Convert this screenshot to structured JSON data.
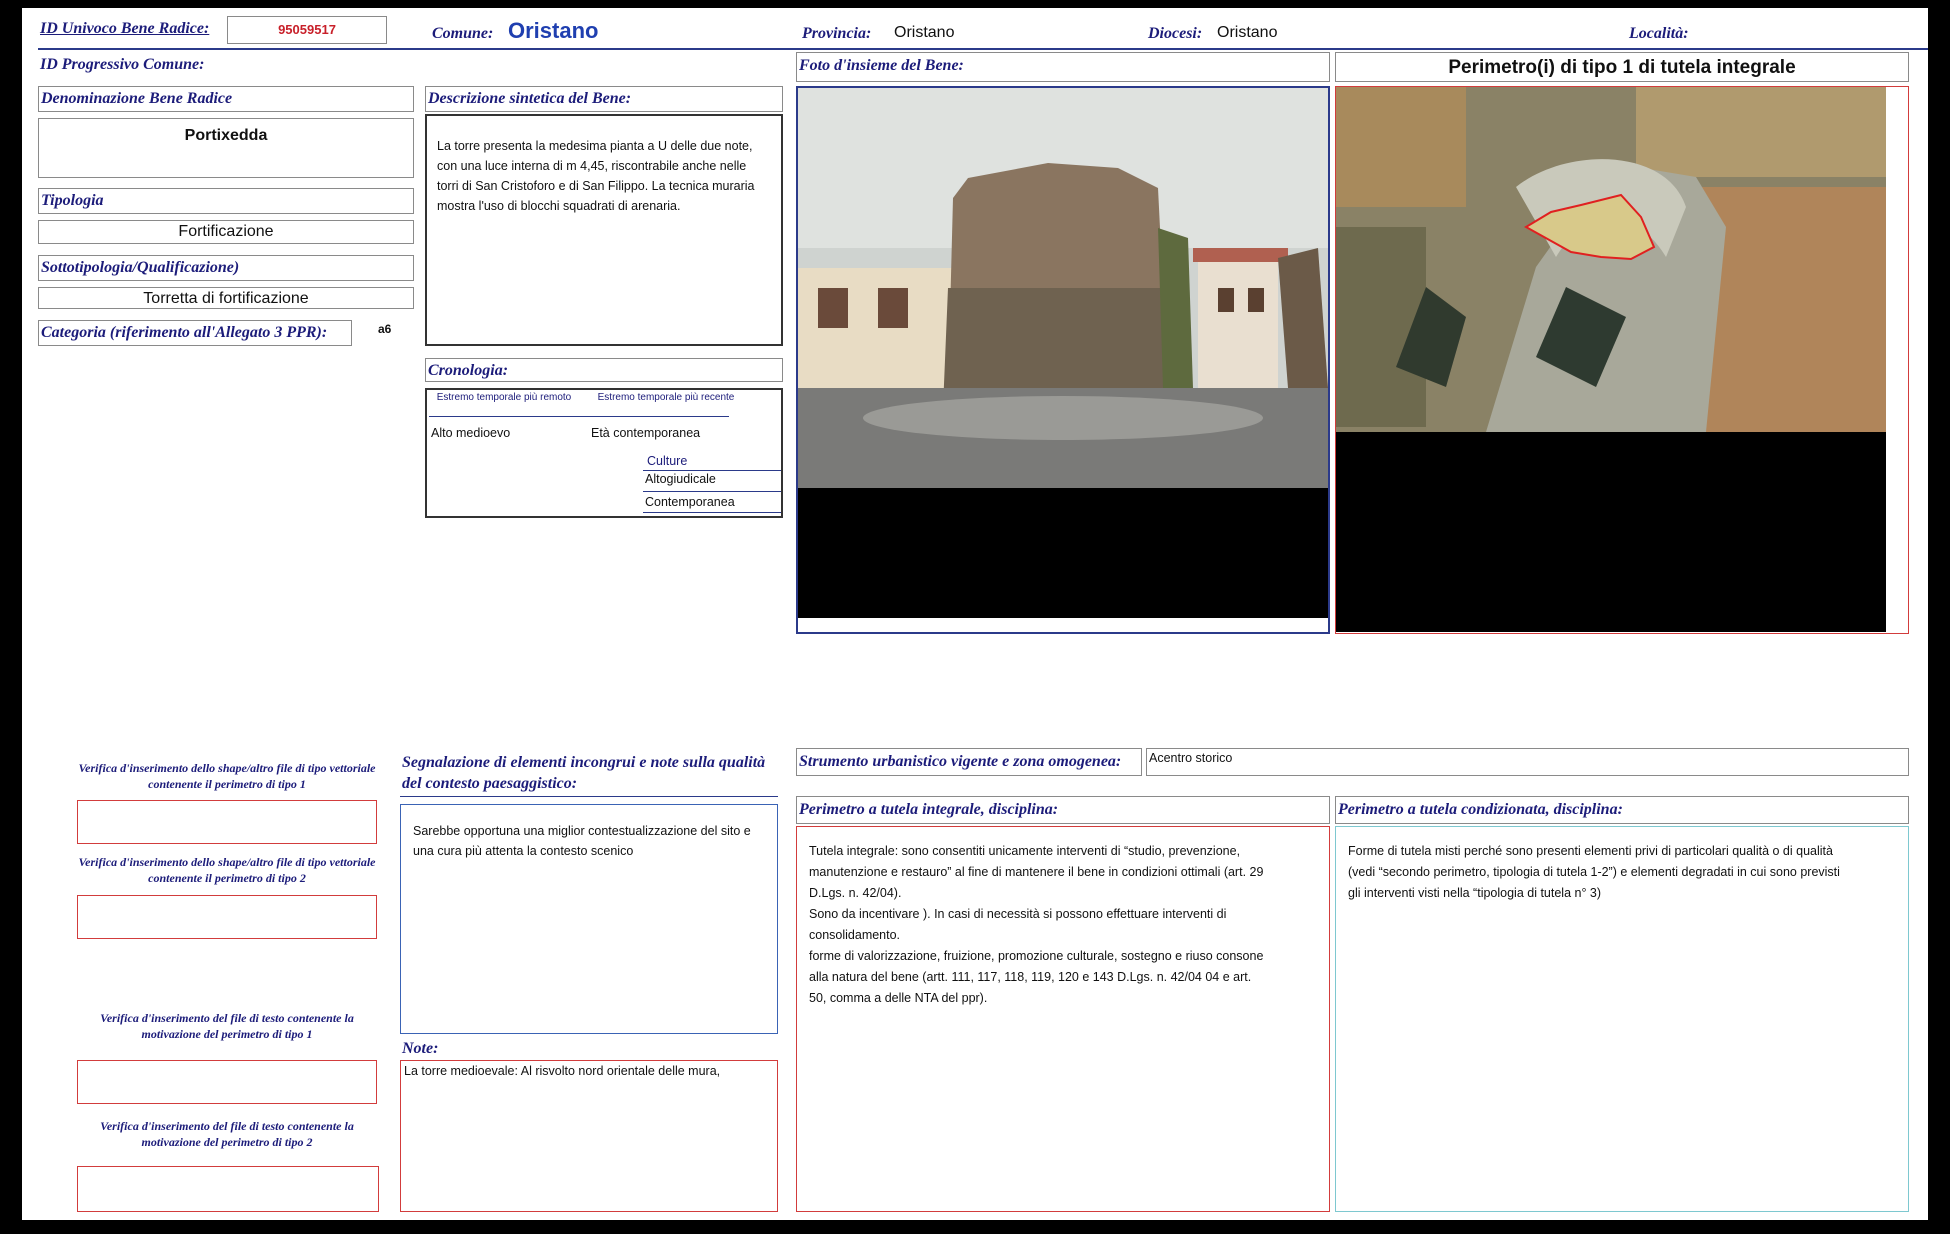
{
  "header": {
    "id_univoco_label": "ID Univoco Bene Radice:",
    "id_univoco_value": "95059517",
    "comune_label": "Comune:",
    "comune_value": "Oristano",
    "provincia_label": "Provincia:",
    "provincia_value": "Oristano",
    "diocesi_label": "Diocesi:",
    "diocesi_value": "Oristano",
    "localita_label": "Località:",
    "id_progressivo_label": "ID Progressivo Comune:"
  },
  "left": {
    "denominazione_label": "Denominazione Bene Radice",
    "denominazione_value": "Portixedda",
    "tipologia_label": "Tipologia",
    "tipologia_value": "Fortificazione",
    "sottotipologia_label": "Sottotipologia/Qualificazione)",
    "sottotipologia_value": "Torretta di fortificazione",
    "categoria_label": "Categoria (riferimento all'Allegato 3 PPR):",
    "categoria_value": "a6"
  },
  "descrizione": {
    "label": "Descrizione sintetica del Bene:",
    "text": "La torre presenta la medesima pianta a U delle due note, con una luce interna di m 4,45, riscontrabile anche nelle torri di San Cristoforo e di San Filippo. La tecnica muraria mostra l'uso di blocchi squadrati di arenaria."
  },
  "cronologia": {
    "label": "Cronologia:",
    "col_remoto": "Estremo temporale più remoto",
    "col_recente": "Estremo temporale più recente",
    "remoto_value": "Alto medioevo",
    "recente_value": "Età contemporanea",
    "culture_label": "Culture",
    "culture_items": [
      "Altogiudicale",
      "Contemporanea"
    ]
  },
  "foto": {
    "label": "Foto d'insieme del Bene:"
  },
  "perimetro": {
    "title": "Perimetro(i) di tipo 1 di tutela integrale"
  },
  "verifiche": {
    "v1": "Verifica d'inserimento dello shape/altro file di tipo vettoriale contenente il perimetro di tipo 1",
    "v2": "Verifica d'inserimento dello shape/altro file di tipo vettoriale contenente il perimetro di tipo 2",
    "v3": "Verifica d'inserimento del  file di testo contenente la motivazione del perimetro di tipo 1",
    "v4": "Verifica d'inserimento del  file di testo contenente la motivazione del perimetro di tipo 2"
  },
  "segnalazione": {
    "label": "Segnalazione di elementi incongrui e note sulla qualità del contesto paesaggistico:",
    "text": "Sarebbe opportuna una miglior contestualizzazione del sito e una cura più attenta la contesto scenico"
  },
  "note": {
    "label": "Note:",
    "text": "La torre medioevale: Al risvolto nord orientale delle mura,"
  },
  "strumento": {
    "label": "Strumento urbanistico vigente e zona omogenea:",
    "value": "Acentro storico"
  },
  "tutela_integrale": {
    "label": "Perimetro a tutela integrale, disciplina:",
    "lines": [
      "Tutela integrale: sono consentiti unicamente interventi di “studio, prevenzione,",
      "manutenzione e restauro”  al fine di mantenere il bene in  condizioni ottimali (art. 29",
      "D.Lgs. n. 42/04).",
      "Sono da incentivare ). In casi di necessità si possono effettuare interventi di",
      "consolidamento.",
      "forme di valorizzazione, fruizione, promozione culturale, sostegno e riuso consone",
      "alla natura del bene (artt. 111, 117, 118, 119,  120 e  143 D.Lgs. n. 42/04 04 e art.",
      "50, comma a delle NTA del ppr)."
    ]
  },
  "tutela_condizionata": {
    "label": "Perimetro a tutela condizionata, disciplina:",
    "lines": [
      "Forme di tutela misti perché sono presenti elementi privi di particolari qualità o di qualità",
      "(vedi “secondo perimetro, tipologia di tutela 1-2”) e elementi degradati  in cui sono previsti",
      "gli interventi visti nella “tipologia di tutela n° 3)"
    ]
  }
}
